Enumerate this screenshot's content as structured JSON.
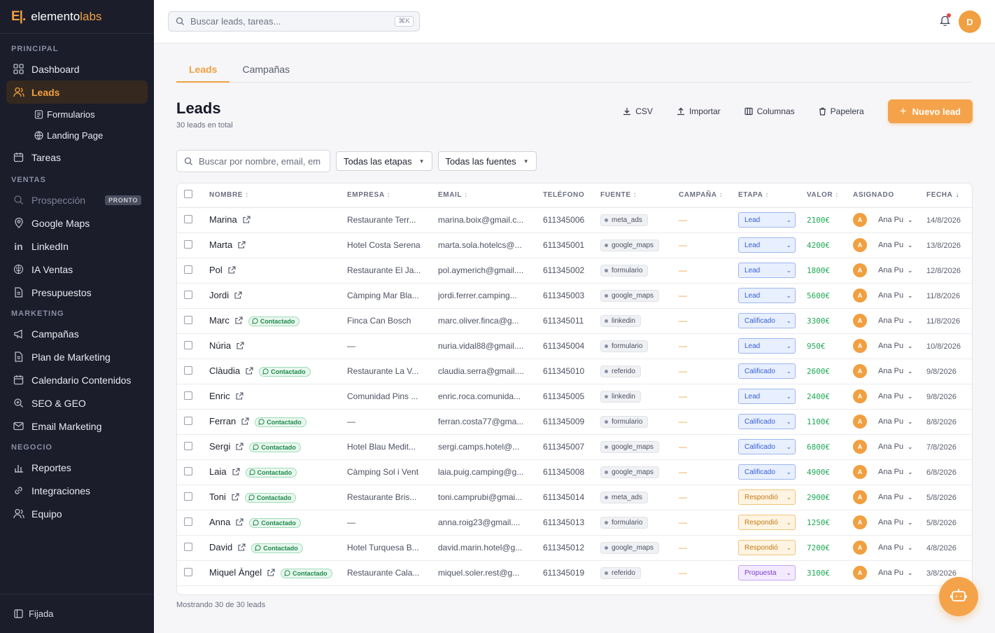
{
  "brand": {
    "mark": "E|.",
    "name_a": "elemento",
    "name_b": "labs"
  },
  "sidebar": {
    "sections": {
      "principal": "PRINCIPAL",
      "ventas": "VENTAS",
      "marketing": "MARKETING",
      "negocio": "NEGOCIO"
    },
    "items": {
      "dashboard": "Dashboard",
      "leads": "Leads",
      "formularios": "Formularios",
      "landing": "Landing Page",
      "tareas": "Tareas",
      "prospeccion": "Prospección",
      "pronto": "PRONTO",
      "google_maps": "Google Maps",
      "linkedin": "LinkedIn",
      "ia_ventas": "IA Ventas",
      "presupuestos": "Presupuestos",
      "campanas": "Campañas",
      "plan_marketing": "Plan de Marketing",
      "calendario": "Calendario Contenidos",
      "seo": "SEO & GEO",
      "email_marketing": "Email Marketing",
      "reportes": "Reportes",
      "integraciones": "Integraciones",
      "equipo": "Equipo"
    },
    "footer": "Fijada"
  },
  "topbar": {
    "search_placeholder": "Buscar leads, tareas...",
    "shortcut": "⌘K",
    "avatar": "D"
  },
  "tabs": {
    "leads": "Leads",
    "campanas": "Campañas"
  },
  "page": {
    "title": "Leads",
    "subtitle": "30 leads en total"
  },
  "actions": {
    "csv": "CSV",
    "importar": "Importar",
    "columnas": "Columnas",
    "papelera": "Papelera",
    "nuevo": "Nuevo lead"
  },
  "filters": {
    "search_placeholder": "Buscar por nombre, email, em",
    "etapas": "Todas las etapas",
    "fuentes": "Todas las fuentes"
  },
  "columns": {
    "nombre": "NOMBRE",
    "empresa": "EMPRESA",
    "email": "EMAIL",
    "telefono": "TELÉFONO",
    "fuente": "FUENTE",
    "campana": "CAMPAÑA",
    "etapa": "ETAPA",
    "valor": "VALOR",
    "asignado": "ASIGNADO",
    "fecha": "FECHA"
  },
  "contact_label": "Contactado",
  "rows": [
    {
      "name": "Marina",
      "contacted": false,
      "company": "Restaurante Terr...",
      "email": "marina.boix@gmail.c...",
      "phone": "611345006",
      "source": "meta_ads",
      "campaign": "—",
      "stage": "Lead",
      "stage_class": "lead",
      "value": "2100€",
      "initial": "A",
      "assignee": "Ana Pu",
      "date": "14/8/2026"
    },
    {
      "name": "Marta",
      "contacted": false,
      "company": "Hotel Costa Serena",
      "email": "marta.sola.hotelcs@...",
      "phone": "611345001",
      "source": "google_maps",
      "campaign": "—",
      "stage": "Lead",
      "stage_class": "lead",
      "value": "4200€",
      "initial": "A",
      "assignee": "Ana Pu",
      "date": "13/8/2026"
    },
    {
      "name": "Pol",
      "contacted": false,
      "company": "Restaurante El Ja...",
      "email": "pol.aymerich@gmail....",
      "phone": "611345002",
      "source": "formulario",
      "campaign": "—",
      "stage": "Lead",
      "stage_class": "lead",
      "value": "1800€",
      "initial": "A",
      "assignee": "Ana Pu",
      "date": "12/8/2026"
    },
    {
      "name": "Jordi",
      "contacted": false,
      "company": "Càmping Mar Bla...",
      "email": "jordi.ferrer.camping...",
      "phone": "611345003",
      "source": "google_maps",
      "campaign": "—",
      "stage": "Lead",
      "stage_class": "lead",
      "value": "5600€",
      "initial": "A",
      "assignee": "Ana Pu",
      "date": "11/8/2026"
    },
    {
      "name": "Marc",
      "contacted": true,
      "company": "Finca Can Bosch",
      "email": "marc.oliver.finca@g...",
      "phone": "611345011",
      "source": "linkedin",
      "campaign": "—",
      "stage": "Calificado",
      "stage_class": "calificado",
      "value": "3300€",
      "initial": "A",
      "assignee": "Ana Pu",
      "date": "11/8/2026"
    },
    {
      "name": "Núria",
      "contacted": false,
      "company": "—",
      "email": "nuria.vidal88@gmail....",
      "phone": "611345004",
      "source": "formulario",
      "campaign": "—",
      "stage": "Lead",
      "stage_class": "lead",
      "value": "950€",
      "initial": "A",
      "assignee": "Ana Pu",
      "date": "10/8/2026"
    },
    {
      "name": "Clàudia",
      "contacted": true,
      "company": "Restaurante La V...",
      "email": "claudia.serra@gmail....",
      "phone": "611345010",
      "source": "referido",
      "campaign": "—",
      "stage": "Calificado",
      "stage_class": "calificado",
      "value": "2600€",
      "initial": "A",
      "assignee": "Ana Pu",
      "date": "9/8/2026"
    },
    {
      "name": "Enric",
      "contacted": false,
      "company": "Comunidad Pins ...",
      "email": "enric.roca.comunida...",
      "phone": "611345005",
      "source": "linkedin",
      "campaign": "—",
      "stage": "Lead",
      "stage_class": "lead",
      "value": "2400€",
      "initial": "A",
      "assignee": "Ana Pu",
      "date": "9/8/2026"
    },
    {
      "name": "Ferran",
      "contacted": true,
      "company": "—",
      "email": "ferran.costa77@gma...",
      "phone": "611345009",
      "source": "formulario",
      "campaign": "—",
      "stage": "Calificado",
      "stage_class": "calificado",
      "value": "1100€",
      "initial": "A",
      "assignee": "Ana Pu",
      "date": "8/8/2026"
    },
    {
      "name": "Sergi",
      "contacted": true,
      "company": "Hotel Blau Medit...",
      "email": "sergi.camps.hotel@...",
      "phone": "611345007",
      "source": "google_maps",
      "campaign": "—",
      "stage": "Calificado",
      "stage_class": "calificado",
      "value": "6800€",
      "initial": "A",
      "assignee": "Ana Pu",
      "date": "7/8/2026"
    },
    {
      "name": "Laia",
      "contacted": true,
      "company": "Càmping Sol i Vent",
      "email": "laia.puig.camping@g...",
      "phone": "611345008",
      "source": "google_maps",
      "campaign": "—",
      "stage": "Calificado",
      "stage_class": "calificado",
      "value": "4900€",
      "initial": "A",
      "assignee": "Ana Pu",
      "date": "6/8/2026"
    },
    {
      "name": "Toni",
      "contacted": true,
      "company": "Restaurante Bris...",
      "email": "toni.camprubi@gmai...",
      "phone": "611345014",
      "source": "meta_ads",
      "campaign": "—",
      "stage": "Respondió",
      "stage_class": "respondio",
      "value": "2900€",
      "initial": "A",
      "assignee": "Ana Pu",
      "date": "5/8/2026"
    },
    {
      "name": "Anna",
      "contacted": true,
      "company": "—",
      "email": "anna.roig23@gmail....",
      "phone": "611345013",
      "source": "formulario",
      "campaign": "—",
      "stage": "Respondió",
      "stage_class": "respondio",
      "value": "1250€",
      "initial": "A",
      "assignee": "Ana Pu",
      "date": "5/8/2026"
    },
    {
      "name": "David",
      "contacted": true,
      "company": "Hotel Turquesa B...",
      "email": "david.marin.hotel@g...",
      "phone": "611345012",
      "source": "google_maps",
      "campaign": "—",
      "stage": "Respondió",
      "stage_class": "respondio",
      "value": "7200€",
      "initial": "A",
      "assignee": "Ana Pu",
      "date": "4/8/2026"
    },
    {
      "name": "Miquel Àngel",
      "contacted": true,
      "company": "Restaurante Cala...",
      "email": "miquel.soler.rest@g...",
      "phone": "611345019",
      "source": "referido",
      "campaign": "—",
      "stage": "Propuesta",
      "stage_class": "propuesta",
      "value": "3100€",
      "initial": "A",
      "assignee": "Ana Pu",
      "date": "3/8/2026"
    }
  ],
  "footer_count": "Mostrando 30 de 30 leads"
}
